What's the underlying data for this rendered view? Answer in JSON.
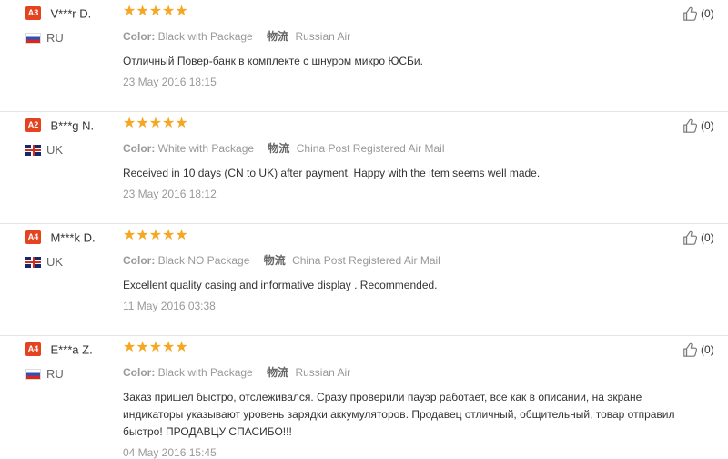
{
  "labels": {
    "color": "Color:"
  },
  "stars": "★★★★★",
  "reviews": [
    {
      "badge": "A3",
      "name": "V***r D.",
      "country": "RU",
      "flag": "ru",
      "color": "Black with Package",
      "ship_icon": "物流",
      "shipping": "Russian Air",
      "text": "Отличный Повер-банк в комплекте с шнуром микро ЮСБи.",
      "date": "23 May 2016 18:15",
      "likes": "(0)"
    },
    {
      "badge": "A2",
      "name": "B***g N.",
      "country": "UK",
      "flag": "uk",
      "color": "White with Package",
      "ship_icon": "物流",
      "shipping": "China Post Registered Air Mail",
      "text": "Received in 10 days (CN to UK) after payment. Happy with the item seems well made.",
      "date": "23 May 2016 18:12",
      "likes": "(0)"
    },
    {
      "badge": "A4",
      "name": "M***k D.",
      "country": "UK",
      "flag": "uk",
      "color": "Black NO Package",
      "ship_icon": "物流",
      "shipping": "China Post Registered Air Mail",
      "text": "Excellent quality casing and informative display . Recommended.",
      "date": "11 May 2016 03:38",
      "likes": "(0)"
    },
    {
      "badge": "A4",
      "name": "E***a Z.",
      "country": "RU",
      "flag": "ru",
      "color": "Black with Package",
      "ship_icon": "物流",
      "shipping": "Russian Air",
      "text": "Заказ пришел быстро, отслеживался. Сразу проверили пауэр работает, все как в описании, на экране индикаторы указывают уровень зарядки аккумуляторов. Продавец отличный, общительный, товар отправил быстро! ПРОДАВЦУ СПАСИБО!!!",
      "date": "04 May 2016 15:45",
      "likes": "(0)"
    }
  ]
}
